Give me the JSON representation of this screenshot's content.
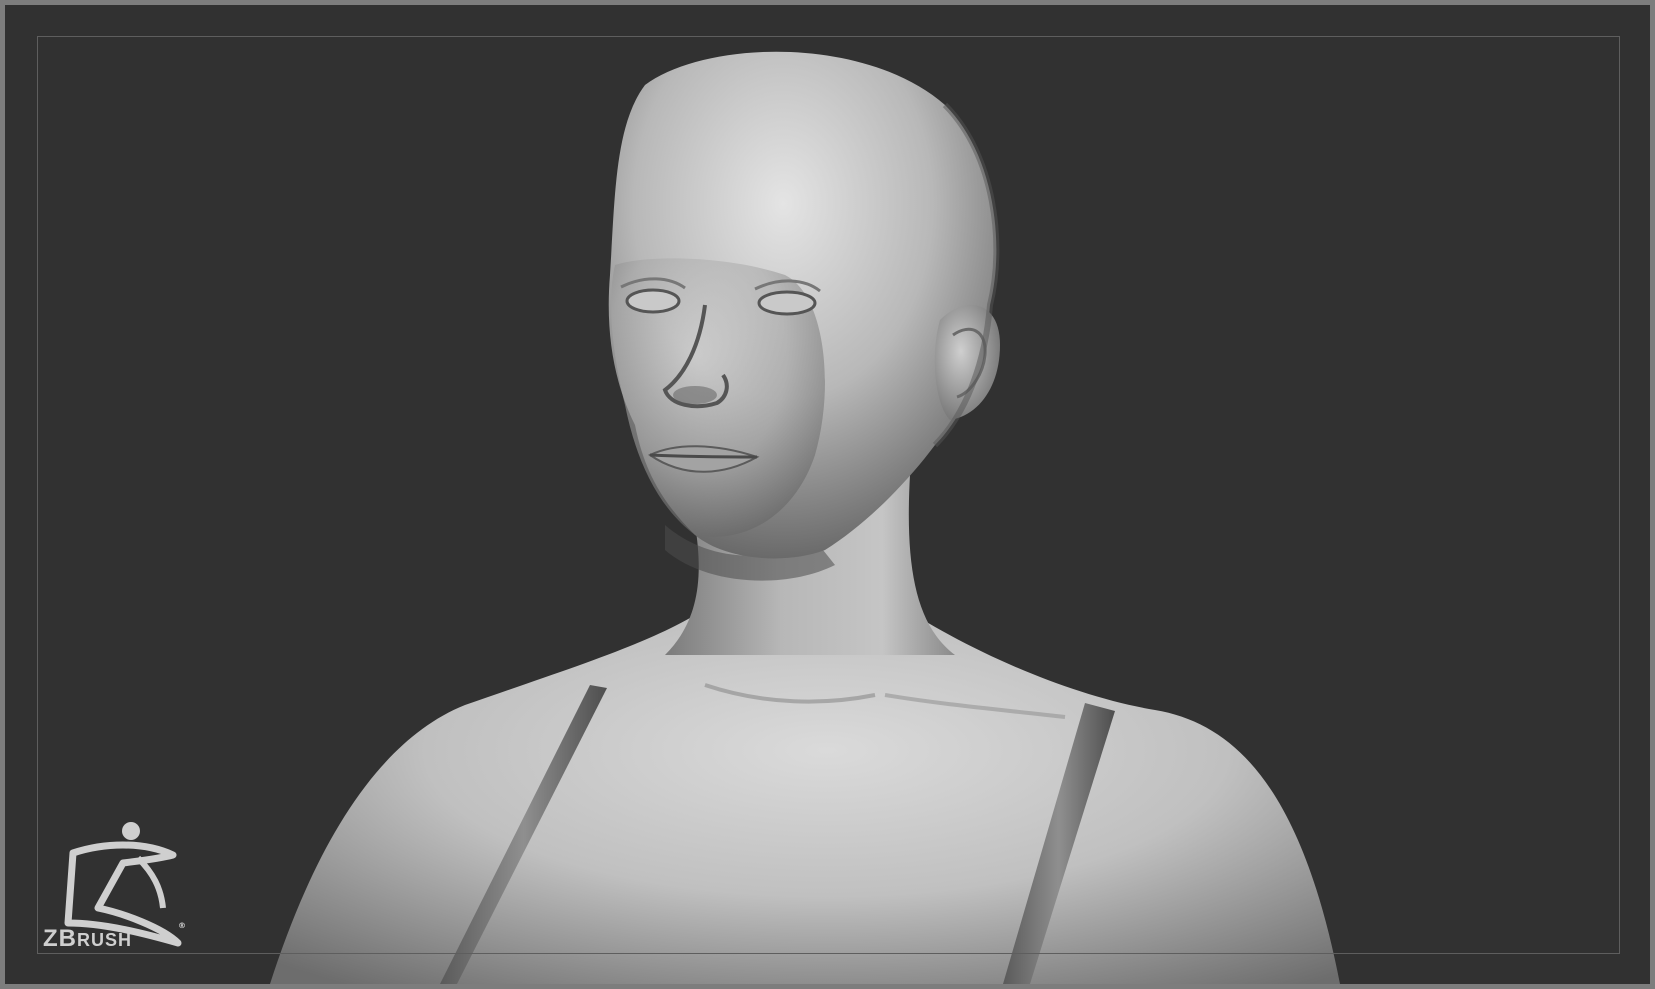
{
  "logo": {
    "brand_big": "ZB",
    "brand_small": "RUSH",
    "registered": "®"
  },
  "colors": {
    "background": "#313131",
    "border": "#7d7d7d",
    "guide": "#5e5e5e",
    "clay_light": "#d6d6d6",
    "clay_mid": "#a9a9a9",
    "clay_dark": "#5d5d5d"
  },
  "icons": {
    "logo_figure": "zbrush-figure-icon"
  }
}
